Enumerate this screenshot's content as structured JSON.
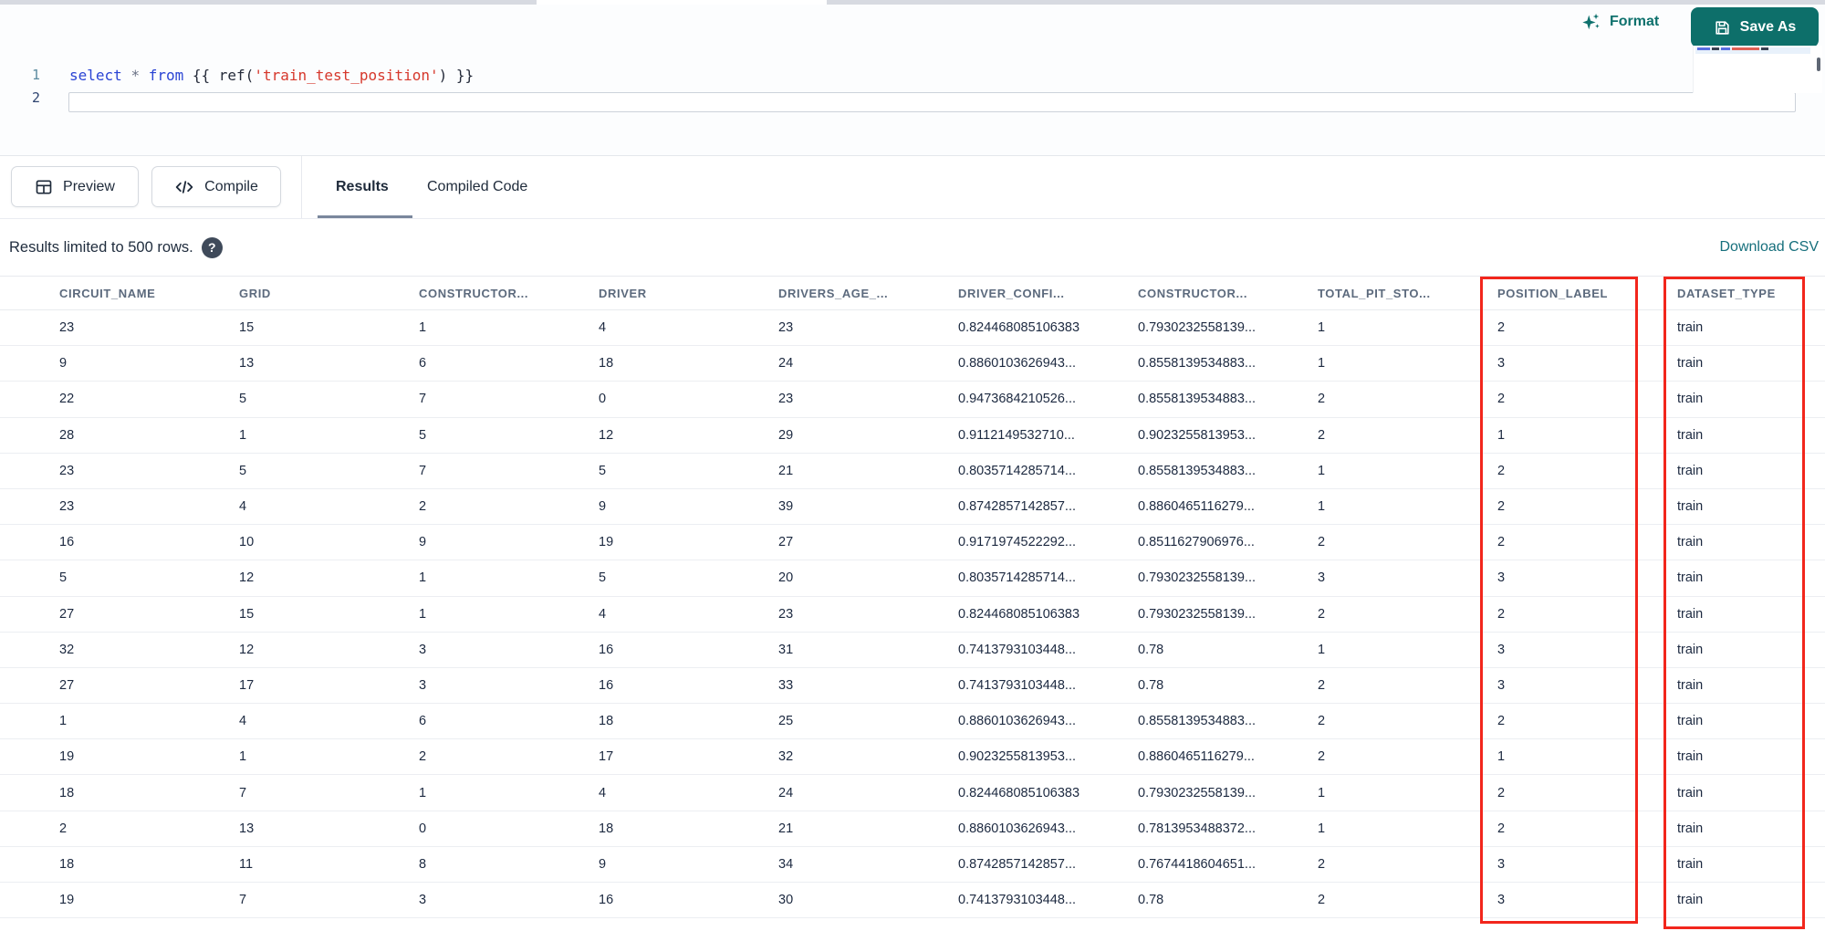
{
  "editor": {
    "line_numbers": [
      "1",
      "2"
    ],
    "code_tokens": [
      {
        "text": "select",
        "type": "keyword"
      },
      {
        "text": " ",
        "type": "plain"
      },
      {
        "text": "*",
        "type": "operator"
      },
      {
        "text": " ",
        "type": "plain"
      },
      {
        "text": "from",
        "type": "keyword"
      },
      {
        "text": " {{ ",
        "type": "plain"
      },
      {
        "text": "ref(",
        "type": "plain"
      },
      {
        "text": "'train_test_position'",
        "type": "string"
      },
      {
        "text": ") }}",
        "type": "plain"
      }
    ],
    "format_label": "Format",
    "save_as_label": "Save As"
  },
  "toolbar": {
    "preview_label": "Preview",
    "compile_label": "Compile",
    "tabs": [
      {
        "label": "Results",
        "active": true
      },
      {
        "label": "Compiled Code",
        "active": false
      }
    ]
  },
  "results": {
    "limit_note": "Results limited to 500 rows.",
    "help_icon": "?",
    "download_label": "Download CSV"
  },
  "table": {
    "columns": [
      "CIRCUIT_NAME",
      "GRID",
      "CONSTRUCTOR...",
      "DRIVER",
      "DRIVERS_AGE_...",
      "DRIVER_CONFI...",
      "CONSTRUCTOR...",
      "TOTAL_PIT_STO...",
      "POSITION_LABEL",
      "DATASET_TYPE"
    ],
    "rows": [
      [
        "23",
        "15",
        "1",
        "4",
        "23",
        "0.824468085106383",
        "0.7930232558139...",
        "1",
        "2",
        "train"
      ],
      [
        "9",
        "13",
        "6",
        "18",
        "24",
        "0.8860103626943...",
        "0.8558139534883...",
        "1",
        "3",
        "train"
      ],
      [
        "22",
        "5",
        "7",
        "0",
        "23",
        "0.9473684210526...",
        "0.8558139534883...",
        "2",
        "2",
        "train"
      ],
      [
        "28",
        "1",
        "5",
        "12",
        "29",
        "0.9112149532710...",
        "0.9023255813953...",
        "2",
        "1",
        "train"
      ],
      [
        "23",
        "5",
        "7",
        "5",
        "21",
        "0.8035714285714...",
        "0.8558139534883...",
        "1",
        "2",
        "train"
      ],
      [
        "23",
        "4",
        "2",
        "9",
        "39",
        "0.8742857142857...",
        "0.8860465116279...",
        "1",
        "2",
        "train"
      ],
      [
        "16",
        "10",
        "9",
        "19",
        "27",
        "0.9171974522292...",
        "0.8511627906976...",
        "2",
        "2",
        "train"
      ],
      [
        "5",
        "12",
        "1",
        "5",
        "20",
        "0.8035714285714...",
        "0.7930232558139...",
        "3",
        "3",
        "train"
      ],
      [
        "27",
        "15",
        "1",
        "4",
        "23",
        "0.824468085106383",
        "0.7930232558139...",
        "2",
        "2",
        "train"
      ],
      [
        "32",
        "12",
        "3",
        "16",
        "31",
        "0.7413793103448...",
        "0.78",
        "1",
        "3",
        "train"
      ],
      [
        "27",
        "17",
        "3",
        "16",
        "33",
        "0.7413793103448...",
        "0.78",
        "2",
        "3",
        "train"
      ],
      [
        "1",
        "4",
        "6",
        "18",
        "25",
        "0.8860103626943...",
        "0.8558139534883...",
        "2",
        "2",
        "train"
      ],
      [
        "19",
        "1",
        "2",
        "17",
        "32",
        "0.9023255813953...",
        "0.8860465116279...",
        "2",
        "1",
        "train"
      ],
      [
        "18",
        "7",
        "1",
        "4",
        "24",
        "0.824468085106383",
        "0.7930232558139...",
        "1",
        "2",
        "train"
      ],
      [
        "2",
        "13",
        "0",
        "18",
        "21",
        "0.8860103626943...",
        "0.7813953488372...",
        "1",
        "2",
        "train"
      ],
      [
        "18",
        "11",
        "8",
        "9",
        "34",
        "0.8742857142857...",
        "0.7674418604651...",
        "2",
        "3",
        "train"
      ],
      [
        "19",
        "7",
        "3",
        "16",
        "30",
        "0.7413793103448...",
        "0.78",
        "2",
        "3",
        "train"
      ]
    ],
    "highlighted_columns": [
      "POSITION_LABEL",
      "DATASET_TYPE"
    ]
  },
  "colors": {
    "accent_teal": "#0d6f6a",
    "link_teal": "#166f7c",
    "highlight_red": "#f2261c",
    "keyword_blue": "#2a44d4",
    "string_red": "#d6382c",
    "header_gray": "#5c6a7d",
    "cell_navy": "#1c2940"
  }
}
